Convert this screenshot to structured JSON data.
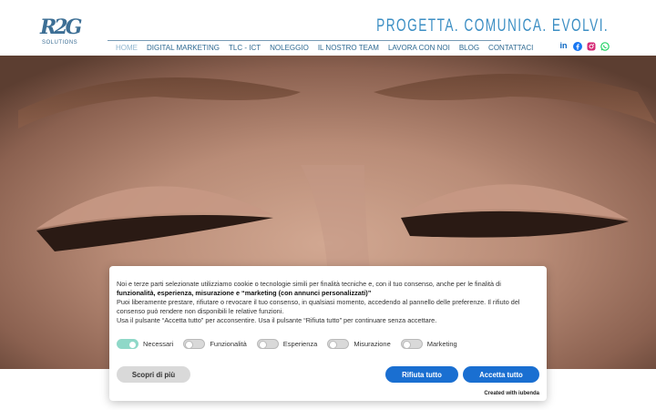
{
  "brand": {
    "logo_mark": "R2G",
    "logo_sub": "SOLUTIONS",
    "slogan": "PROGETTA. COMUNICA. EVOLVI."
  },
  "nav": {
    "items": [
      {
        "label": "HOME",
        "active": true
      },
      {
        "label": "DIGITAL MARKETING",
        "active": false
      },
      {
        "label": "TLC - ICT",
        "active": false
      },
      {
        "label": "NOLEGGIO",
        "active": false
      },
      {
        "label": "IL NOSTRO TEAM",
        "active": false
      },
      {
        "label": "LAVORA CON NOI",
        "active": false
      },
      {
        "label": "BLOG",
        "active": false
      },
      {
        "label": "CONTATTACI",
        "active": false
      }
    ]
  },
  "socials": {
    "linkedin": "in",
    "colors": {
      "linkedin": "#0a66c2",
      "facebook": "#1877f2",
      "instagram": "#d62976",
      "whatsapp": "#25d366"
    }
  },
  "cookie": {
    "line1_prefix": "Noi e terze parti selezionate utilizziamo cookie o tecnologie simili per finalità tecniche e, con il tuo consenso, anche per le finalità di",
    "line1_bold": "funzionalità, esperienza, misurazione e “marketing (con annunci personalizzati)”",
    "line2": "Puoi liberamente prestare, rifiutare o revocare il tuo consenso, in qualsiasi momento, accedendo al pannello delle preferenze. Il rifiuto del consenso può rendere non disponibili le relative funzioni.",
    "line3": "Usa il pulsante “Accetta tutto” per acconsentire. Usa il pulsante “Rifiuta tutto” per continuare senza accettare.",
    "toggles": [
      {
        "label": "Necessari",
        "on": true
      },
      {
        "label": "Funzionalità",
        "on": false
      },
      {
        "label": "Esperienza",
        "on": false
      },
      {
        "label": "Misurazione",
        "on": false
      },
      {
        "label": "Marketing",
        "on": false
      }
    ],
    "learn_more": "Scopri di più",
    "reject_all": "Rifiuta tutto",
    "accept_all": "Accetta tutto",
    "created_with": "Created with iubenda"
  },
  "colors": {
    "accent": "#1a6fd1",
    "brand": "#3d6f95",
    "toggle_on": "#8fd8c8"
  }
}
